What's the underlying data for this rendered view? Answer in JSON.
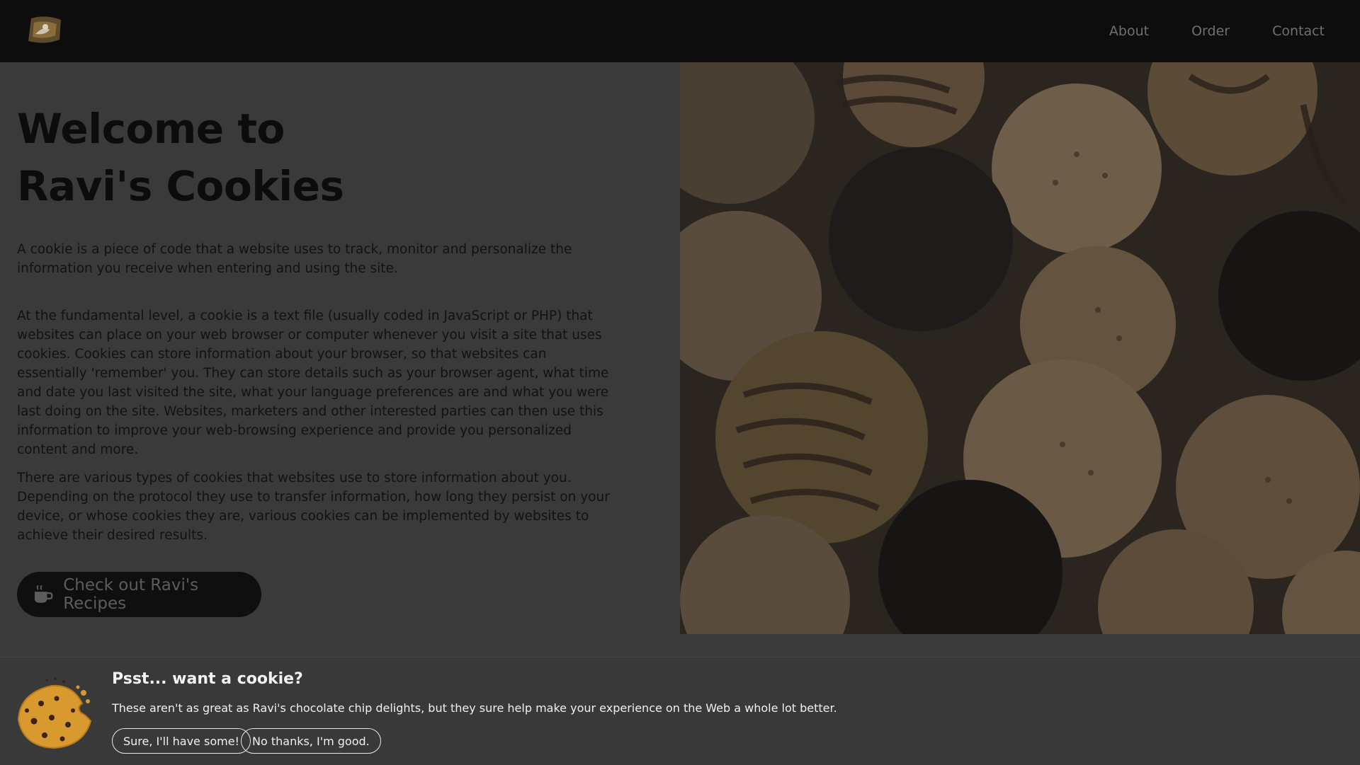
{
  "nav": {
    "links": [
      "About",
      "Order",
      "Contact"
    ]
  },
  "main": {
    "title_line1": "Welcome to",
    "title_line2": "Ravi's Cookies",
    "paragraphs": [
      "A cookie is a piece of code that a website uses to track, monitor and personalize the information you receive when entering and using the site.",
      "At the fundamental level, a cookie is a text file (usually coded in JavaScript or PHP) that websites can place on your web browser or computer whenever you visit a site that uses cookies. Cookies can store information about your browser, so that websites can essentially 'remember' you. They can store details such as your browser agent, what time and date you last visited the site, what your language preferences are and what you were last doing on the site. Websites, marketers and other interested parties can then use this information to improve your web-browsing experience and provide you personalized content and more.",
      "There are various types of cookies that websites use to store information about you. Depending on the protocol they use to transfer information, how long they persist on your device, or whose cookies they are, various cookies can be implemented by websites to achieve their desired results."
    ],
    "cta_label": "Check out Ravi's Recipes"
  },
  "banner": {
    "title": "Psst... want a cookie?",
    "text": "These aren't as great as Ravi's chocolate chip delights, but they sure help make your experience on the Web a whole lot better.",
    "accept_label": "Sure, I'll have some!",
    "decline_label": "No thanks, I'm good."
  },
  "colors": {
    "nav_bg": "#0d0d0d",
    "page_bg": "#3a3a3a",
    "banner_bg": "#393939",
    "cta_bg": "#0f0f0f"
  }
}
